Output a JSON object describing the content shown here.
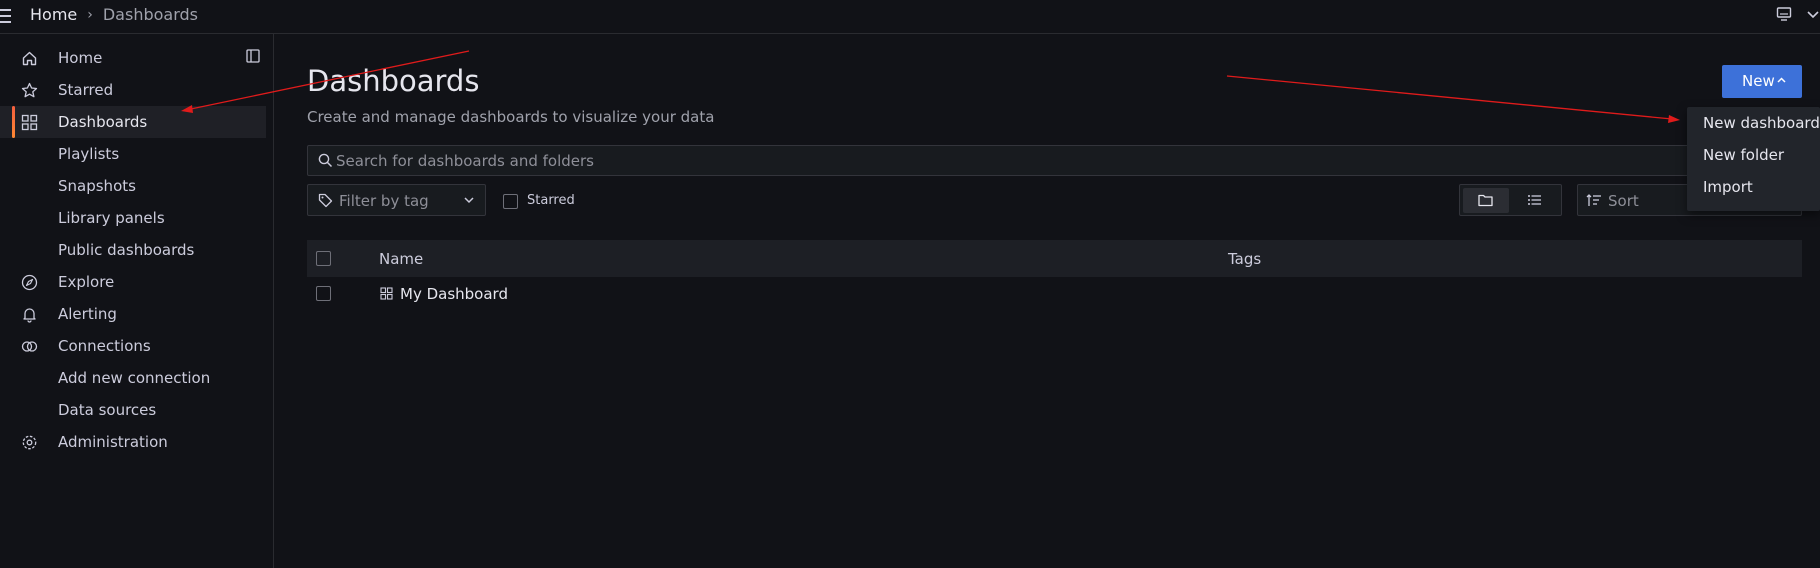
{
  "breadcrumb": {
    "home": "Home",
    "separator": "›",
    "current": "Dashboards"
  },
  "sidebar": {
    "items": [
      {
        "label": "Home",
        "icon": "home-icon"
      },
      {
        "label": "Starred",
        "icon": "star-icon"
      },
      {
        "label": "Dashboards",
        "icon": "apps-icon",
        "active": true
      },
      {
        "label": "Playlists"
      },
      {
        "label": "Snapshots"
      },
      {
        "label": "Library panels"
      },
      {
        "label": "Public dashboards"
      },
      {
        "label": "Explore",
        "icon": "compass-icon"
      },
      {
        "label": "Alerting",
        "icon": "bell-icon"
      },
      {
        "label": "Connections",
        "icon": "link-icon"
      },
      {
        "label": "Add new connection"
      },
      {
        "label": "Data sources"
      },
      {
        "label": "Administration",
        "icon": "cog-icon"
      }
    ]
  },
  "page": {
    "title": "Dashboards",
    "subtitle": "Create and manage dashboards to visualize your data"
  },
  "search": {
    "placeholder": "Search for dashboards and folders",
    "value": ""
  },
  "filters": {
    "tag_filter": "Filter by tag",
    "starred_label": "Starred",
    "sort_label": "Sort",
    "view_mode": "folders"
  },
  "table": {
    "columns": [
      "Name",
      "Tags"
    ],
    "rows": [
      {
        "name": "My Dashboard",
        "tags": ""
      }
    ]
  },
  "new_button": {
    "label": "New",
    "menu": [
      "New dashboard",
      "New folder",
      "Import"
    ]
  },
  "colors": {
    "accent": "#3d71d9",
    "active_indicator": "#f55f3e",
    "background": "#111217"
  }
}
